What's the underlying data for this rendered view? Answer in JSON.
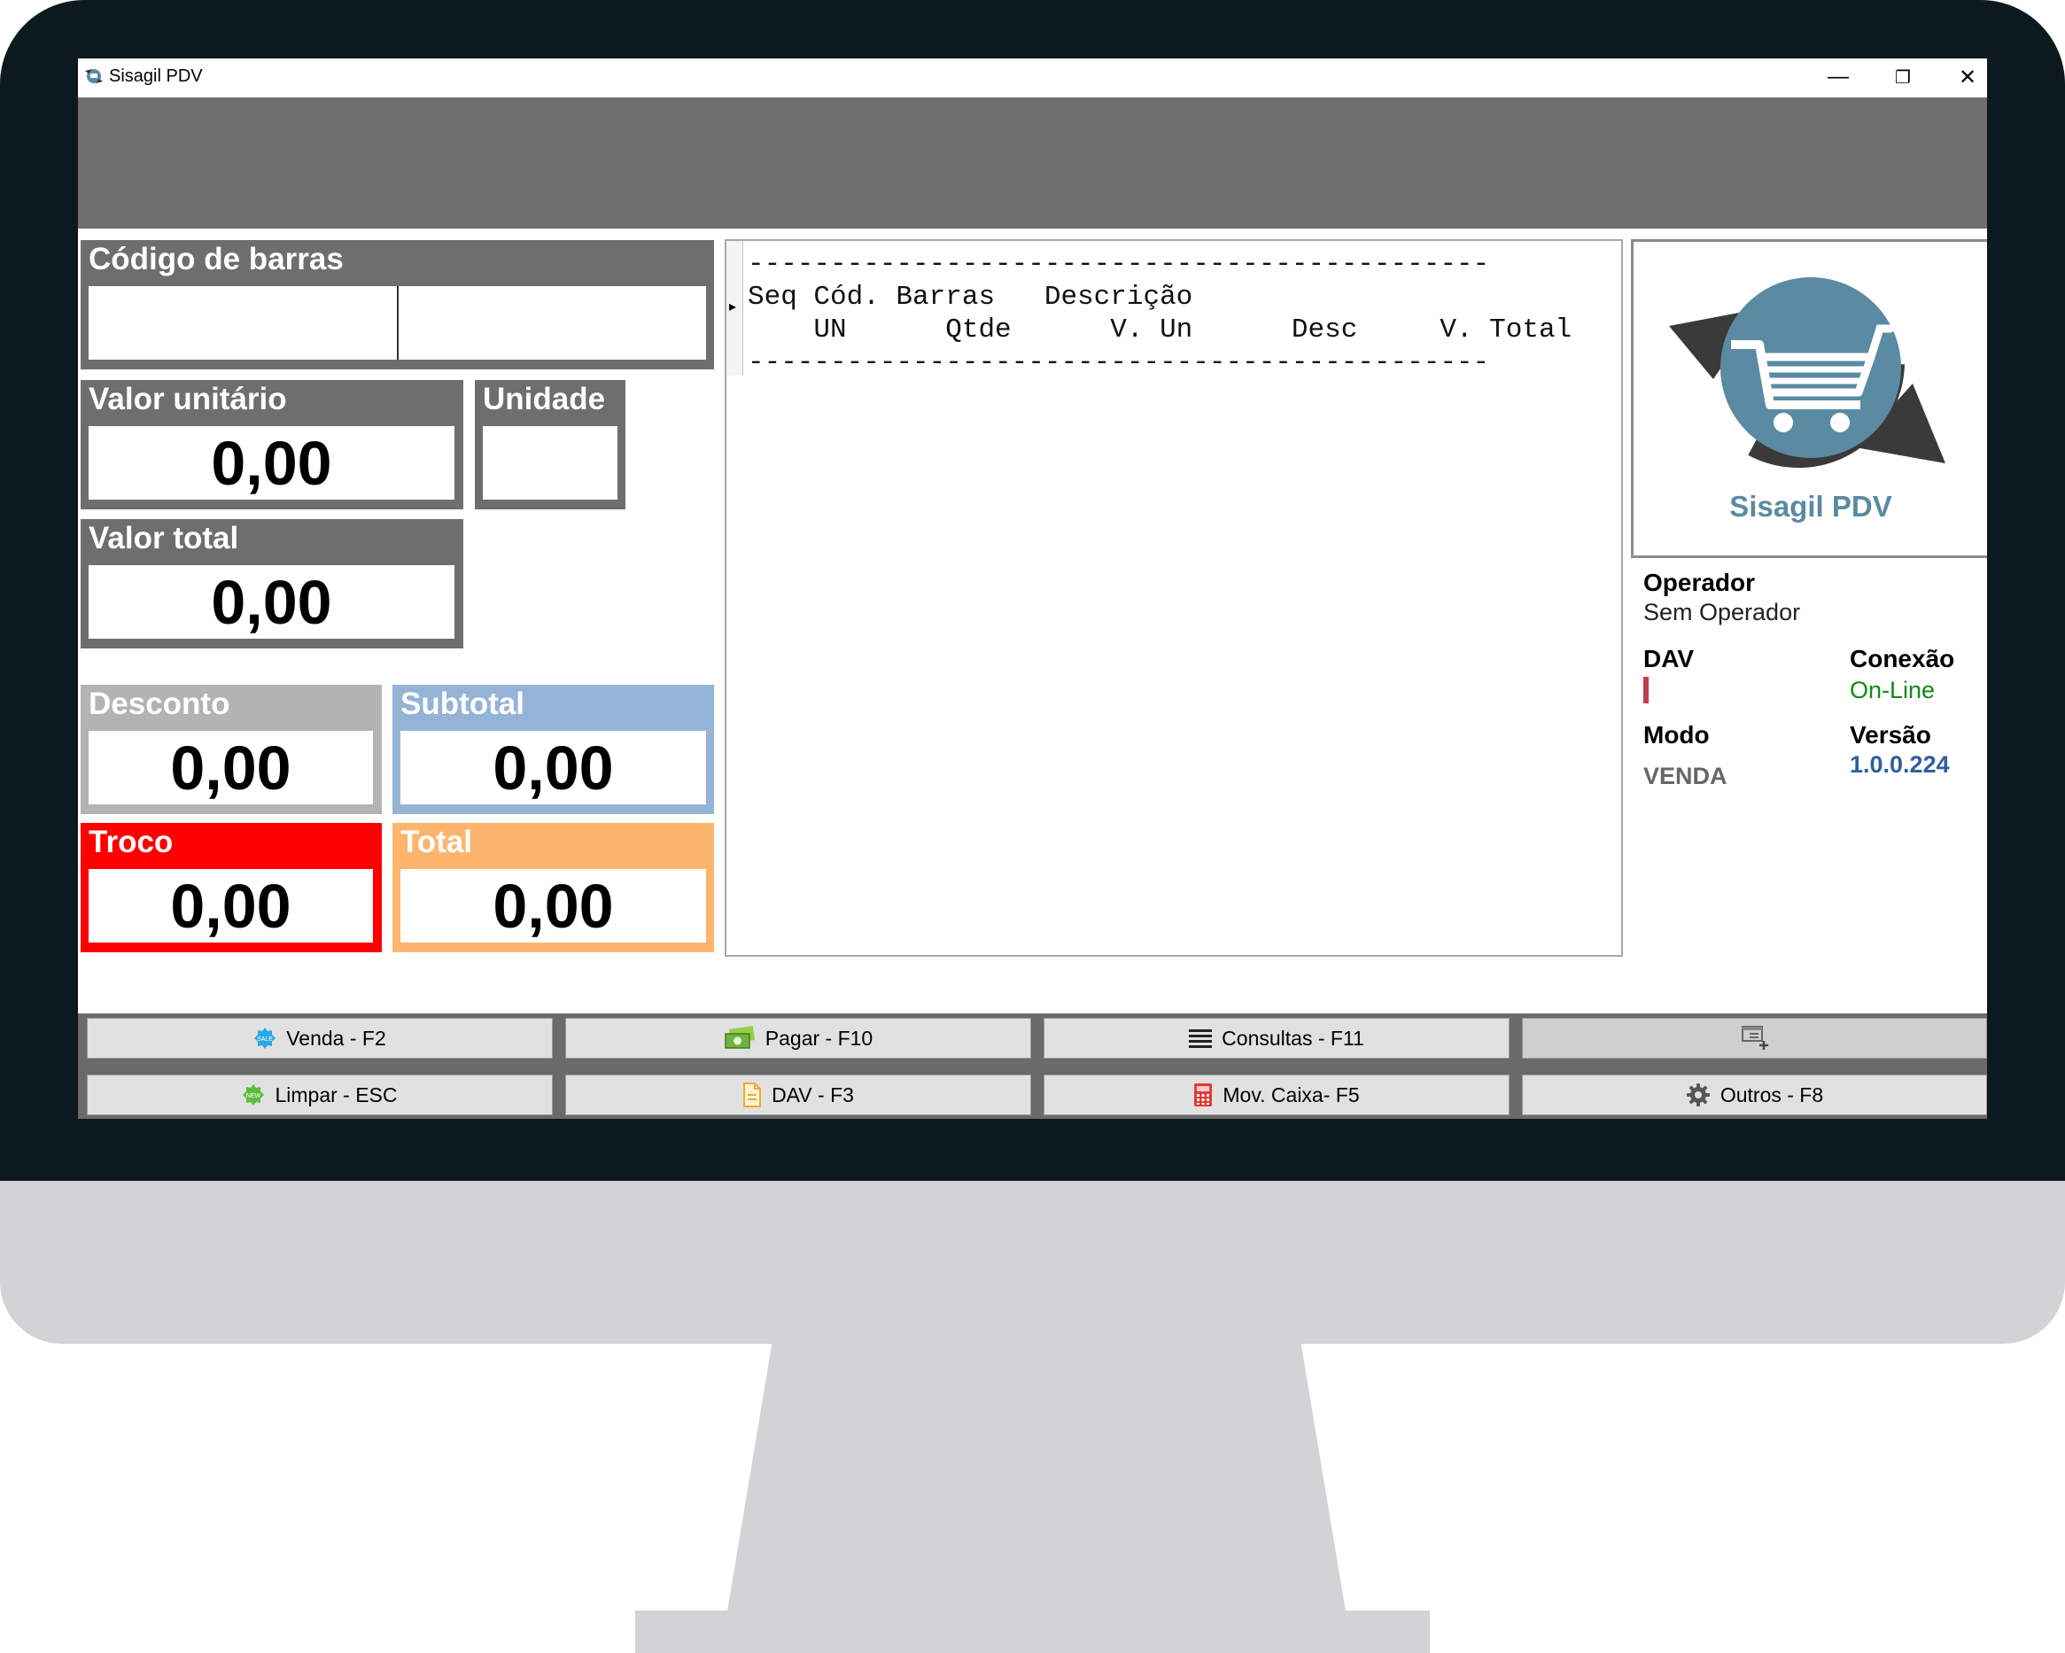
{
  "window": {
    "title": "Sisagil PDV",
    "controls": {
      "minimize": "—",
      "maximize": "❐",
      "close": "✕"
    }
  },
  "panels": {
    "barcode": {
      "label": "Código de barras",
      "value": ""
    },
    "unit_value": {
      "label": "Valor unitário",
      "value": "0,00"
    },
    "unit": {
      "label": "Unidade",
      "value": ""
    },
    "total_value": {
      "label": "Valor total",
      "value": "0,00"
    },
    "discount": {
      "label": "Desconto",
      "value": "0,00"
    },
    "subtotal": {
      "label": "Subtotal",
      "value": "0,00"
    },
    "change": {
      "label": "Troco",
      "value": "0,00"
    },
    "total": {
      "label": "Total",
      "value": "0,00"
    }
  },
  "items_list": {
    "header_lines": [
      "---------------------------------------------",
      "Seq Cód. Barras   Descrição",
      "    UN      Qtde      V. Un      Desc     V. Total",
      "---------------------------------------------"
    ]
  },
  "logo": {
    "text": "Sisagil PDV"
  },
  "info": {
    "operator_label": "Operador",
    "operator_value": "Sem Operador",
    "dav_label": "DAV",
    "connection_label": "Conexão",
    "connection_value": "On-Line",
    "mode_label": "Modo",
    "mode_value": "VENDA",
    "version_label": "Versão",
    "version_value": "1.0.0.224"
  },
  "buttons": {
    "sale": "Venda - F2",
    "pay": "Pagar - F10",
    "queries": "Consultas - F11",
    "clear": "Limpar - ESC",
    "dav": "DAV - F3",
    "cash_movement": "Mov. Caixa- F5",
    "others": "Outros - F8"
  },
  "colors": {
    "panel_gray": "#6e6e6e",
    "discount": "#b3b3b3",
    "subtotal": "#95b3d7",
    "change": "#ff0000",
    "total": "#fdb56e",
    "online": "#0e8a16",
    "version": "#2f5e9e",
    "logo": "#5b8aa3"
  },
  "icons": {
    "app": "sisagil-logo-icon",
    "sale": "sale-badge-icon",
    "pay": "money-icon",
    "queries": "list-icon",
    "extra": "window-add-icon",
    "clear": "new-badge-icon",
    "dav": "document-icon",
    "cash_movement": "calculator-icon",
    "others": "gear-icon"
  }
}
